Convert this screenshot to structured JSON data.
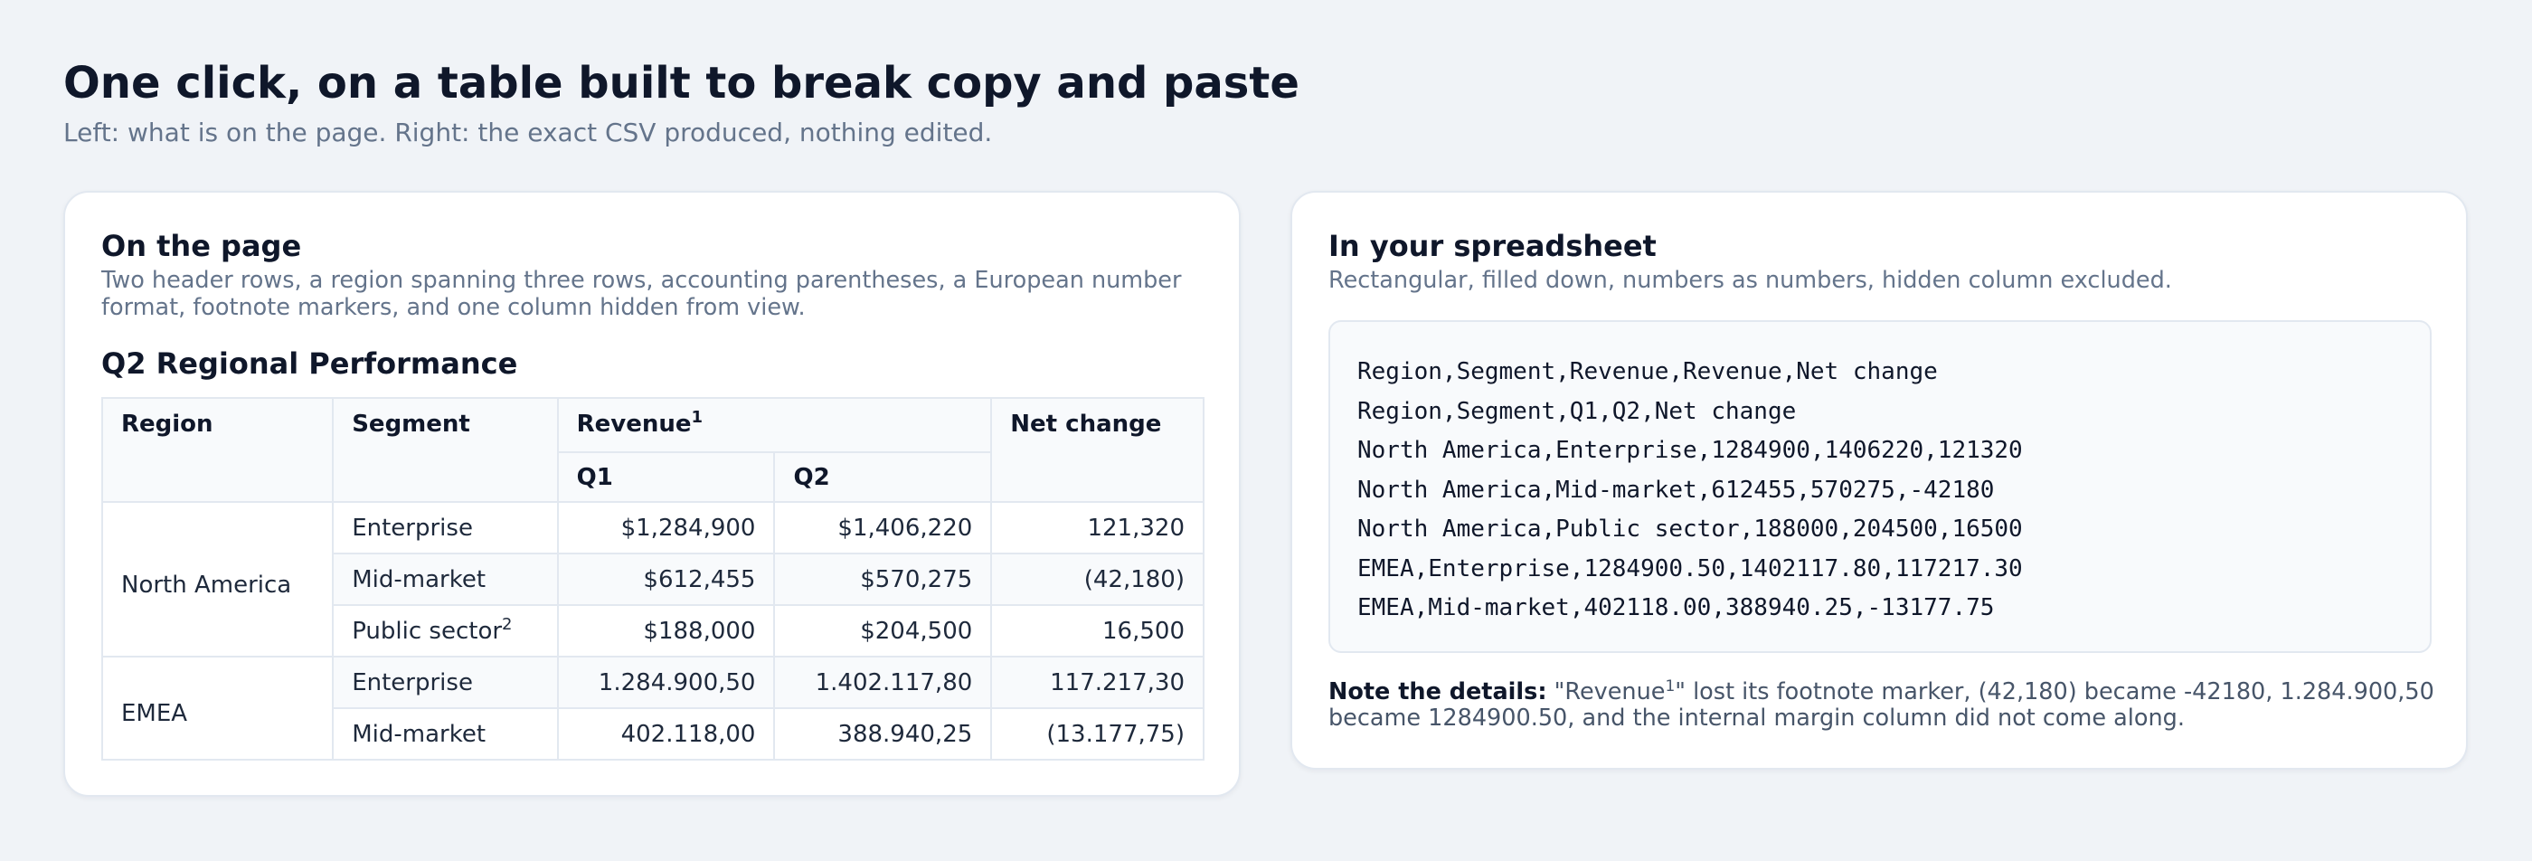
{
  "page": {
    "title": "One click, on a table built to break copy and paste",
    "subtitle": "Left: what is on the page. Right: the exact CSV produced, nothing edited."
  },
  "left_card": {
    "title": "On the page",
    "description": "Two header rows, a region spanning three rows, accounting parentheses, a European number format, footnote markers, and one column hidden from view.",
    "table_title": "Q2 Regional Performance",
    "headers": {
      "region": "Region",
      "segment": "Segment",
      "revenue": "Revenue",
      "revenue_footnote": "1",
      "q1": "Q1",
      "q2": "Q2",
      "net_change": "Net change"
    },
    "rows": [
      {
        "region": "North America",
        "segment": "Enterprise",
        "footnote": "",
        "q1": "$1,284,900",
        "q2": "$1,406,220",
        "net": "121,320"
      },
      {
        "region": "",
        "segment": "Mid-market",
        "footnote": "",
        "q1": "$612,455",
        "q2": "$570,275",
        "net": "(42,180)"
      },
      {
        "region": "",
        "segment": "Public sector",
        "footnote": "2",
        "q1": "$188,000",
        "q2": "$204,500",
        "net": "16,500"
      },
      {
        "region": "EMEA",
        "segment": "Enterprise",
        "footnote": "",
        "q1": "1.284.900,50",
        "q2": "1.402.117,80",
        "net": "117.217,30"
      },
      {
        "region": "",
        "segment": "Mid-market",
        "footnote": "",
        "q1": "402.118,00",
        "q2": "388.940,25",
        "net": "(13.177,75)"
      }
    ]
  },
  "right_card": {
    "title": "In your spreadsheet",
    "description": "Rectangular, filled down, numbers as numbers, hidden column excluded.",
    "csv_lines": [
      "Region,Segment,Revenue,Revenue,Net change",
      "Region,Segment,Q1,Q2,Net change",
      "North America,Enterprise,1284900,1406220,121320",
      "North America,Mid-market,612455,570275,-42180",
      "North America,Public sector,188000,204500,16500",
      "EMEA,Enterprise,1284900.50,1402117.80,117217.30",
      "EMEA,Mid-market,402118.00,388940.25,-13177.75"
    ],
    "note": {
      "label": "Note the details:",
      "text_before": " \"Revenue",
      "sup": "1",
      "text_after": "\" lost its footnote marker, (42,180) became -42180, 1.284.900,50 became 1284900.50, and the internal margin column did not come along."
    }
  }
}
